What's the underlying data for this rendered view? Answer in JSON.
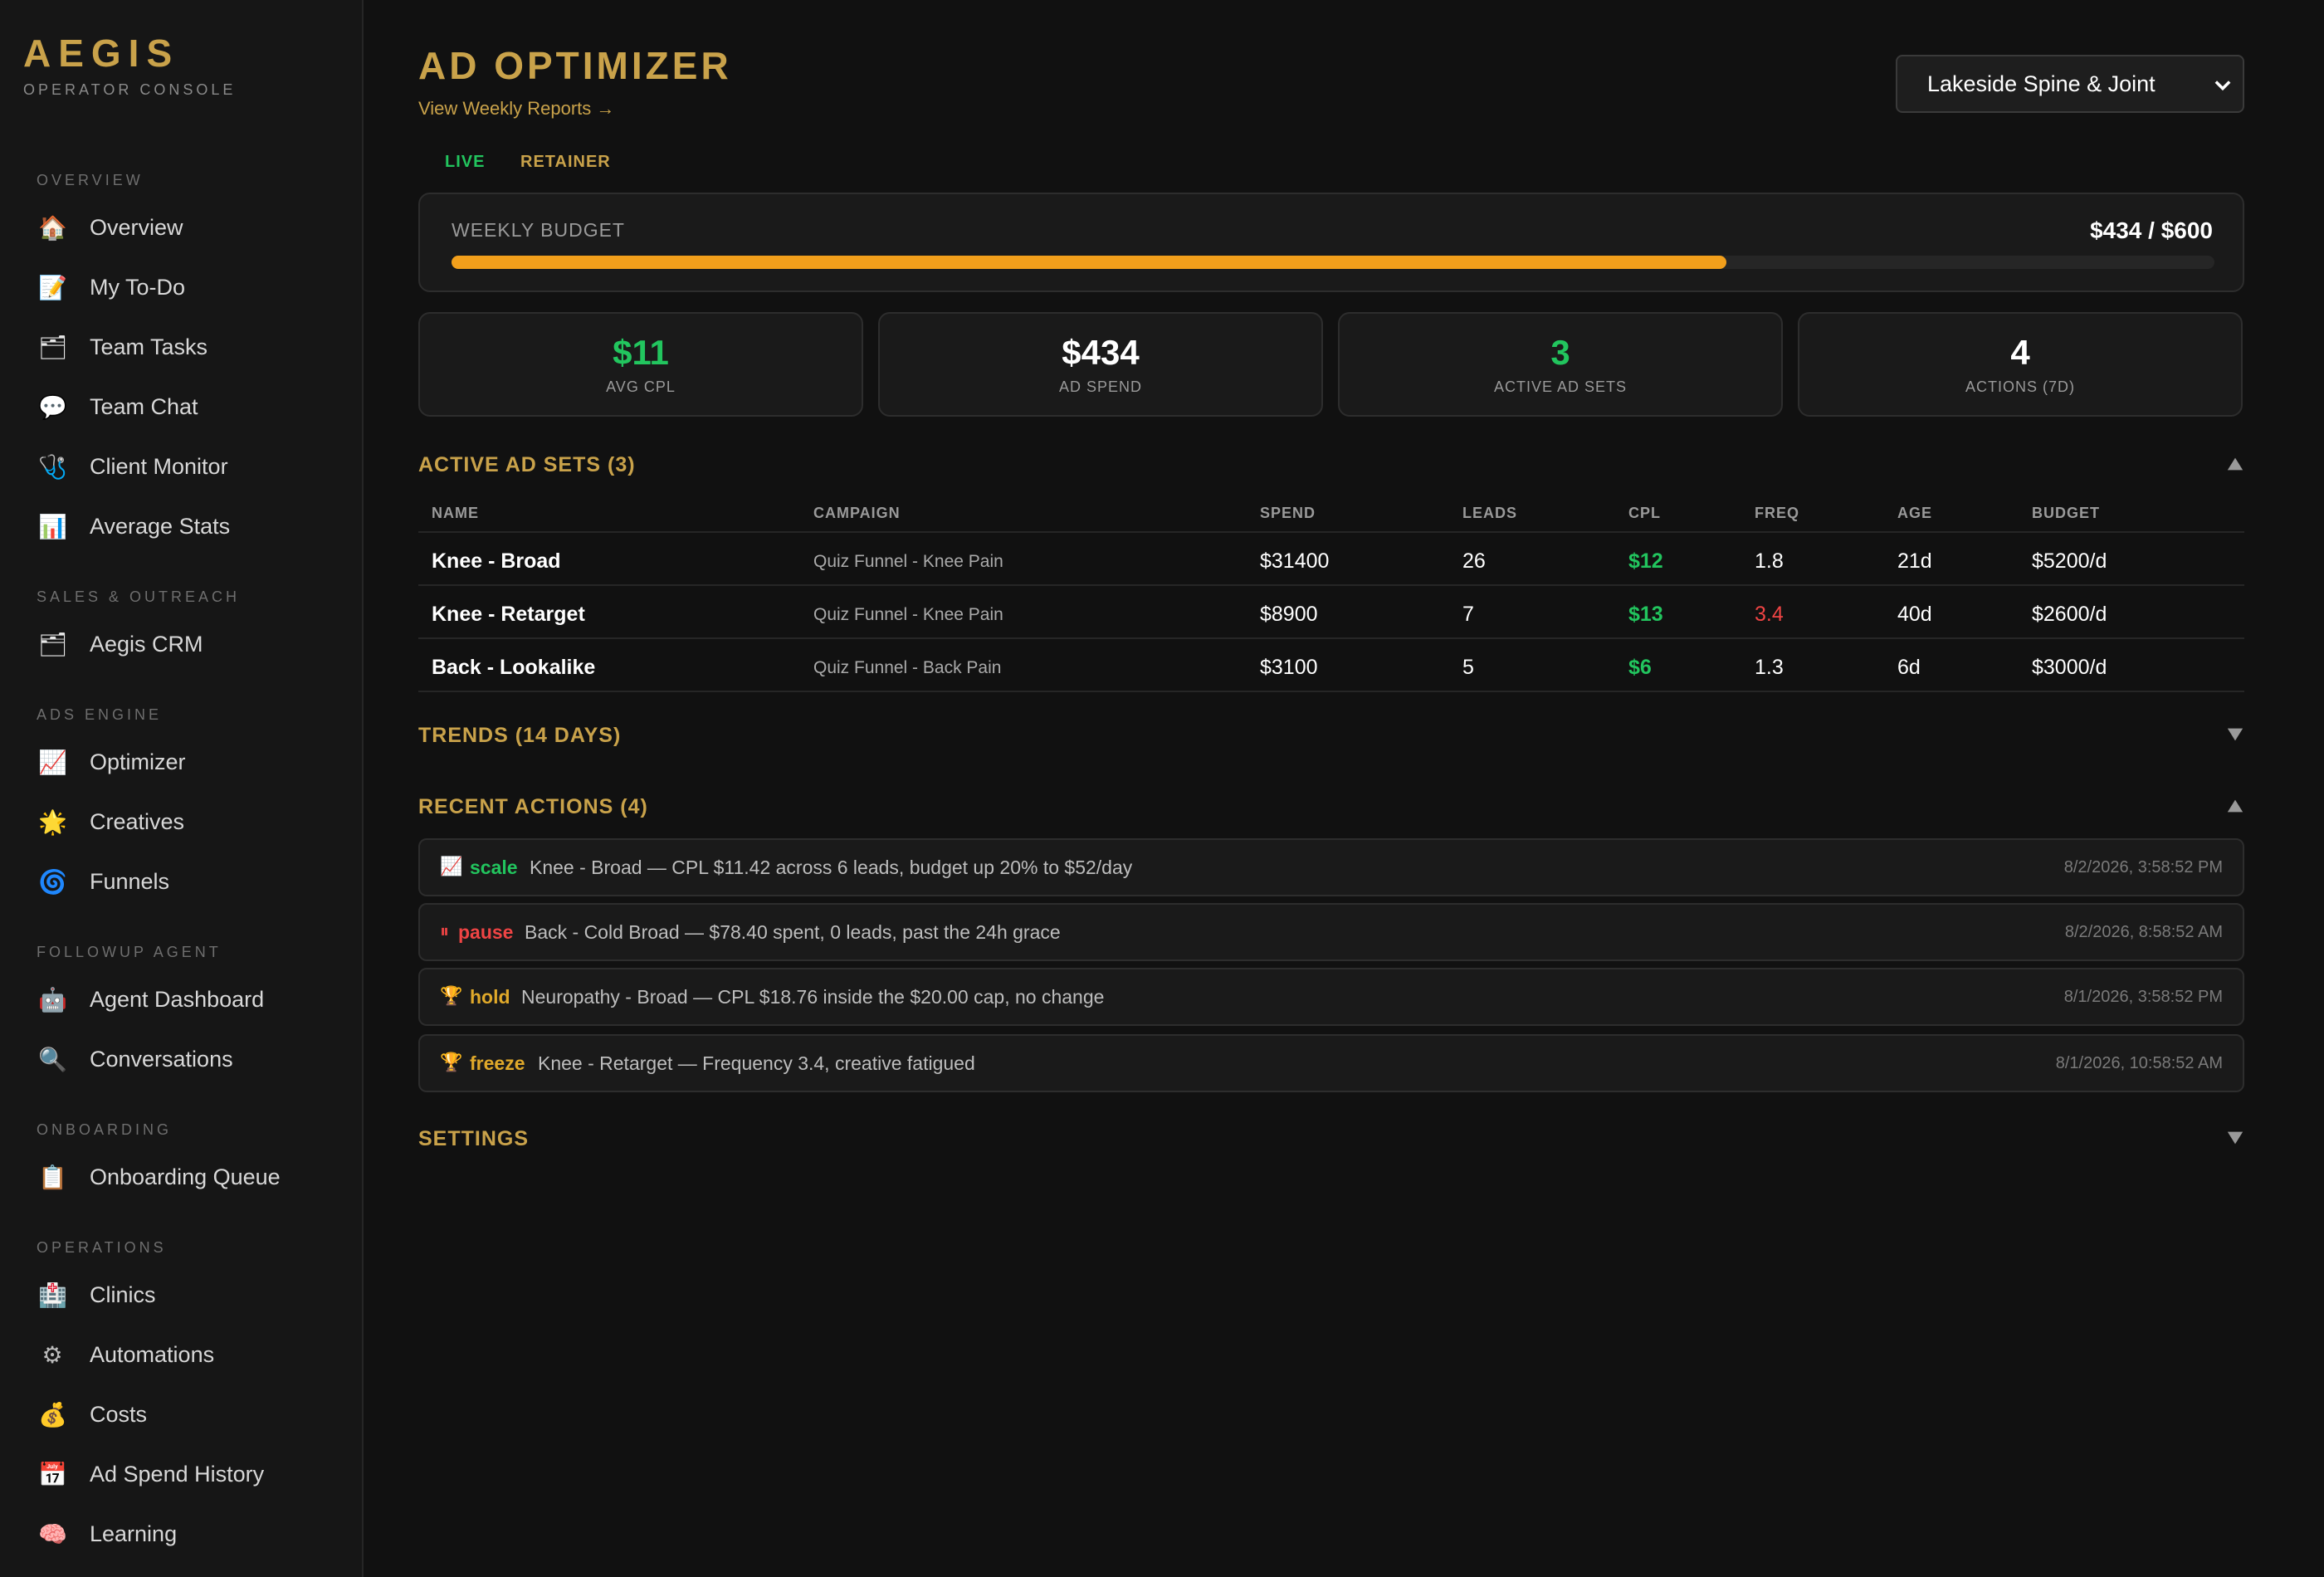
{
  "brand": {
    "title": "AEGIS",
    "subtitle": "OPERATOR CONSOLE"
  },
  "sidebar": {
    "sections": [
      {
        "label": "OVERVIEW",
        "items": [
          {
            "label": "Overview",
            "icon": "🏠"
          },
          {
            "label": "My To-Do",
            "icon": "📝"
          },
          {
            "label": "Team Tasks",
            "icon": "🗂"
          },
          {
            "label": "Team Chat",
            "icon": "💬"
          },
          {
            "label": "Client Monitor",
            "icon": "🩺"
          },
          {
            "label": "Average Stats",
            "icon": "📊"
          }
        ]
      },
      {
        "label": "SALES & OUTREACH",
        "items": [
          {
            "label": "Aegis CRM",
            "icon": "🗂"
          }
        ]
      },
      {
        "label": "ADS ENGINE",
        "items": [
          {
            "label": "Optimizer",
            "icon": "📈"
          },
          {
            "label": "Creatives",
            "icon": "🌟"
          },
          {
            "label": "Funnels",
            "icon": "🌀"
          }
        ]
      },
      {
        "label": "FOLLOWUP AGENT",
        "items": [
          {
            "label": "Agent Dashboard",
            "icon": "🤖"
          },
          {
            "label": "Conversations",
            "icon": "🔍"
          }
        ]
      },
      {
        "label": "ONBOARDING",
        "items": [
          {
            "label": "Onboarding Queue",
            "icon": "📋"
          }
        ]
      },
      {
        "label": "OPERATIONS",
        "items": [
          {
            "label": "Clinics",
            "icon": "🏥"
          },
          {
            "label": "Automations",
            "icon": "⚙"
          },
          {
            "label": "Costs",
            "icon": "💰"
          },
          {
            "label": "Ad Spend History",
            "icon": "📅"
          },
          {
            "label": "Learning",
            "icon": "🧠"
          }
        ]
      }
    ]
  },
  "header": {
    "title": "AD OPTIMIZER",
    "reports_link": "View Weekly Reports →",
    "client_select": "Lakeside Spine & Joint"
  },
  "tabs": [
    {
      "label": "LIVE",
      "color": "#22c55e"
    },
    {
      "label": "RETAINER",
      "color": "#c9a24a"
    }
  ],
  "budget": {
    "label": "WEEKLY BUDGET",
    "value_text": "$434 / $600",
    "spent": 434,
    "total": 600
  },
  "stats": [
    {
      "value": "$11",
      "label": "AVG CPL",
      "color": "#22c55e"
    },
    {
      "value": "$434",
      "label": "AD SPEND",
      "color": "#ffffff"
    },
    {
      "value": "3",
      "label": "ACTIVE AD SETS",
      "color": "#22c55e"
    },
    {
      "value": "4",
      "label": "ACTIONS (7D)",
      "color": "#ffffff"
    }
  ],
  "ad_sets": {
    "title": "ACTIVE AD SETS (3)",
    "columns": [
      "NAME",
      "CAMPAIGN",
      "SPEND",
      "LEADS",
      "CPL",
      "FREQ",
      "AGE",
      "BUDGET"
    ],
    "rows": [
      {
        "name": "Knee - Broad",
        "campaign": "Quiz Funnel - Knee Pain",
        "spend": "$31400",
        "leads": "26",
        "cpl": "$12",
        "freq": "1.8",
        "age": "21d",
        "budget": "$5200/d"
      },
      {
        "name": "Knee - Retarget",
        "campaign": "Quiz Funnel - Knee Pain",
        "spend": "$8900",
        "leads": "7",
        "cpl": "$13",
        "freq": "3.4",
        "age": "40d",
        "budget": "$2600/d"
      },
      {
        "name": "Back - Lookalike",
        "campaign": "Quiz Funnel - Back Pain",
        "spend": "$3100",
        "leads": "5",
        "cpl": "$6",
        "freq": "1.3",
        "age": "6d",
        "budget": "$3000/d"
      }
    ]
  },
  "trends": {
    "title": "TRENDS (14 DAYS)"
  },
  "recent_actions": {
    "title": "RECENT ACTIONS (4)",
    "items": [
      {
        "icon": "📈",
        "type": "scale",
        "type_color": "#22c55e",
        "text": "Knee - Broad — CPL $11.42 across 6 leads, budget up 20% to $52/day",
        "time": "8/2/2026, 3:58:52 PM"
      },
      {
        "icon": "⏸",
        "type": "pause",
        "type_color": "#ef4444",
        "text": "Back - Cold Broad — $78.40 spent, 0 leads, past the 24h grace",
        "time": "8/2/2026, 8:58:52 AM"
      },
      {
        "icon": "🏆",
        "type": "hold",
        "type_color": "#e0a92a",
        "text": "Neuropathy - Broad — CPL $18.76 inside the $20.00 cap, no change",
        "time": "8/1/2026, 3:58:52 PM"
      },
      {
        "icon": "🏆",
        "type": "freeze",
        "type_color": "#e0a92a",
        "text": "Knee - Retarget — Frequency 3.4, creative fatigued",
        "time": "8/1/2026, 10:58:52 AM"
      }
    ]
  },
  "settings": {
    "title": "SETTINGS"
  }
}
